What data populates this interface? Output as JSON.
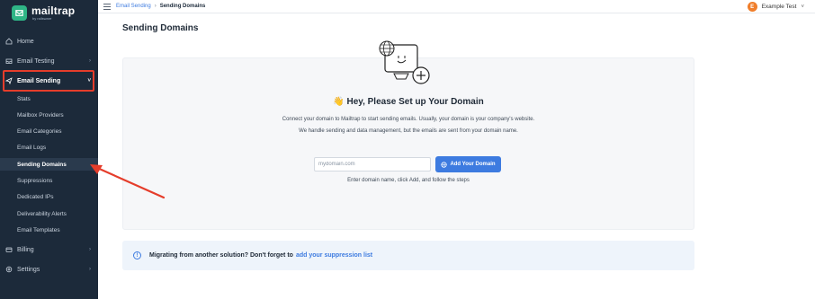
{
  "brand": {
    "name": "mailtrap",
    "sub": "by railsware"
  },
  "sidebar": {
    "items": [
      {
        "label": "Home",
        "icon": "home-icon"
      },
      {
        "label": "Email Testing",
        "icon": "inbox-icon"
      },
      {
        "label": "Email Sending",
        "icon": "send-icon"
      },
      {
        "label": "Billing",
        "icon": "billing-icon"
      },
      {
        "label": "Settings",
        "icon": "gear-icon"
      }
    ],
    "sub_items": [
      {
        "label": "Stats"
      },
      {
        "label": "Mailbox Providers"
      },
      {
        "label": "Email Categories"
      },
      {
        "label": "Email Logs"
      },
      {
        "label": "Sending Domains"
      },
      {
        "label": "Suppressions"
      },
      {
        "label": "Dedicated IPs"
      },
      {
        "label": "Deliverability Alerts"
      },
      {
        "label": "Email Templates"
      }
    ]
  },
  "topbar": {
    "breadcrumb_parent": "Email Sending",
    "breadcrumb_current": "Sending Domains",
    "user_initial": "E",
    "user_name": "Example Test"
  },
  "main": {
    "title": "Sending Domains",
    "hero_title": "👋 Hey, Please Set up Your Domain",
    "desc_line1": "Connect your domain to Mailtrap to start sending emails. Usually, your domain is your company's website.",
    "desc_line2": "We handle sending and data management, but the emails are sent from your domain name.",
    "input_placeholder": "mydomain.com",
    "add_button": "Add Your Domain",
    "hint": "Enter domain name, click Add, and follow the steps",
    "banner_text": "Migrating from another solution? Don't forget to",
    "banner_link": "add your suppression list"
  },
  "colors": {
    "sidebar_bg": "#1c2a3a",
    "accent": "#3d7be0",
    "brand_green": "#2fb586",
    "annotation_red": "#e53d2b"
  }
}
